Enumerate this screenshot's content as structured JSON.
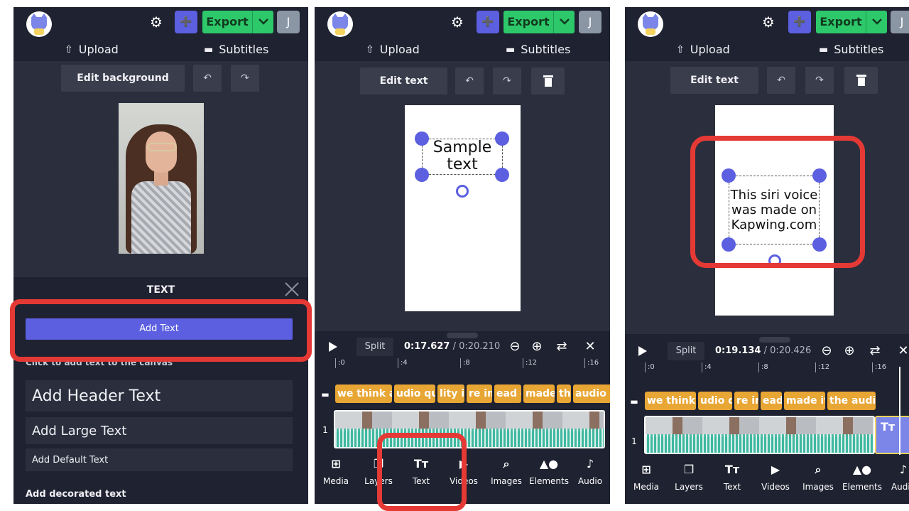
{
  "panel1": {
    "header": {
      "export_label": "Export",
      "avatar_initial": "J"
    },
    "nav": {
      "upload": "Upload",
      "subtitles": "Subtitles"
    },
    "toolbar": {
      "edit_background": "Edit background",
      "undo": "↶",
      "redo": "↷"
    },
    "text_panel": {
      "title": "TEXT",
      "add_text": "Add Text",
      "hint": "Click to add text to the canvas",
      "options": [
        "Add Header Text",
        "Add Large Text",
        "Add Default Text"
      ],
      "decorated": "Add decorated text"
    }
  },
  "panel2": {
    "header": {
      "export_label": "Export",
      "avatar_initial": "J"
    },
    "nav": {
      "upload": "Upload",
      "subtitles": "Subtitles"
    },
    "toolbar": {
      "edit_text": "Edit text",
      "undo": "↶",
      "redo": "↷"
    },
    "canvas_text_line1": "Sample",
    "canvas_text_line2": "text",
    "timeline": {
      "split": "Split",
      "current": "0:17.627",
      "total": "/ 0:20.210",
      "ruler": [
        ":0",
        ":4",
        ":8",
        ":12",
        ":16"
      ],
      "subtitle_clips": [
        "we think a",
        "udio qua",
        "lity is",
        "re im",
        "ead o",
        "made it",
        "the",
        "audio lev"
      ],
      "track_number": "1"
    },
    "bottom_nav": [
      "Media",
      "Layers",
      "Text",
      "Videos",
      "Images",
      "Elements",
      "Audio"
    ]
  },
  "panel3": {
    "header": {
      "export_label": "Export",
      "avatar_initial": "J"
    },
    "nav": {
      "upload": "Upload",
      "subtitles": "Subtitles"
    },
    "toolbar": {
      "edit_text": "Edit text",
      "undo": "↶",
      "redo": "↷"
    },
    "canvas_text": [
      "This siri voice",
      "was made on",
      "Kapwing.com"
    ],
    "timeline": {
      "split": "Split",
      "current": "0:19.134",
      "total": "/ 0:20.426",
      "ruler": [
        ":0",
        ":4",
        ":8",
        ":12",
        ":16"
      ],
      "subtitle_clips": [
        "we think a",
        "udio qua",
        "re im",
        "ead o",
        "made it",
        "the audio le"
      ],
      "track_number": "1",
      "text_clip": "Tт"
    },
    "bottom_nav": [
      "Media",
      "Layers",
      "Text",
      "Videos",
      "Images",
      "Elements",
      "Audio"
    ]
  },
  "colors": {
    "accent": "#5b5fe0",
    "export": "#2dc86a",
    "highlight": "#e53935",
    "subtitle_clip": "#e8a634",
    "audio": "#3fb8a0"
  }
}
